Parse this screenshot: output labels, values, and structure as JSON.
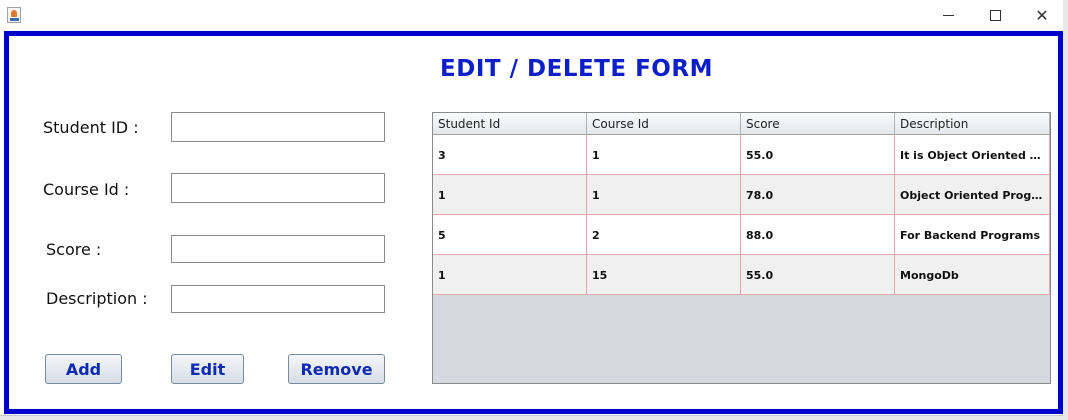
{
  "window": {
    "icon": "java-cup-icon",
    "controls": {
      "minimize": "minimize-icon",
      "maximize": "maximize-icon",
      "close": "✕"
    }
  },
  "form": {
    "title": "EDIT / DELETE FORM",
    "fields": [
      {
        "label": "Student ID :",
        "value": ""
      },
      {
        "label": "Course Id :",
        "value": ""
      },
      {
        "label": "Score :",
        "value": ""
      },
      {
        "label": "Description :",
        "value": ""
      }
    ],
    "buttons": {
      "add": "Add",
      "edit": "Edit",
      "remove": "Remove"
    }
  },
  "table": {
    "columns": [
      "Student Id",
      "Course Id",
      "Score",
      "Description"
    ],
    "rows": [
      [
        "3",
        "1",
        "55.0",
        "It is Object Oriented Pr..."
      ],
      [
        "1",
        "1",
        "78.0",
        "Object Oriented Progra..."
      ],
      [
        "5",
        "2",
        "88.0",
        "For Backend Programs"
      ],
      [
        "1",
        "15",
        "55.0",
        "MongoDb"
      ]
    ]
  },
  "colors": {
    "accent": "#0000cc",
    "title": "#0d1fc8",
    "button_text": "#0d2ab0",
    "grid_line": "#e2a8a8"
  }
}
